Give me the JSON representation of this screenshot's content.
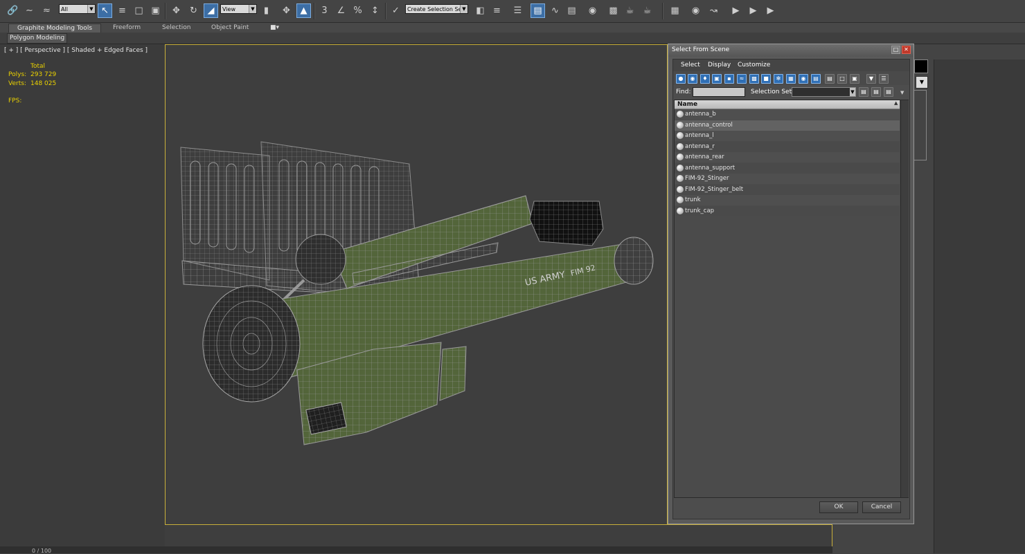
{
  "toolbar": {
    "filter_combo": "All",
    "refcoord_combo": "View",
    "selection_set_combo": "Create Selection Se",
    "snap_label": "3",
    "angle_snap_label": "%"
  },
  "ribbon": {
    "tabs": [
      "Graphite Modeling Tools",
      "Freeform",
      "Selection",
      "Object Paint"
    ],
    "panel": "Polygon Modeling"
  },
  "viewport": {
    "label": "[ + ] [ Perspective ] [ Shaded + Edged Faces ]",
    "stats": {
      "total_label": "Total",
      "polys_label": "Polys:",
      "polys_value": "293 729",
      "verts_label": "Verts:",
      "verts_value": "148 025",
      "fps_label": "FPS:"
    },
    "decal_text_1": "US ARMY",
    "decal_text_2": "FIM 92"
  },
  "timeline": {
    "frame": "0 / 100"
  },
  "dialog": {
    "title": "Select From Scene",
    "menu": [
      "Select",
      "Display",
      "Customize"
    ],
    "find_label": "Find:",
    "find_value": "",
    "selection_set_label": "Selection Set:",
    "column_header": "Name",
    "objects": [
      "antenna_b",
      "antenna_control",
      "antenna_l",
      "antenna_r",
      "antenna_rear",
      "antenna_support",
      "FIM-92_Stinger",
      "FIM-92_Stinger_belt",
      "trunk",
      "trunk_cap"
    ],
    "highlighted_object": "antenna_control",
    "ok_label": "OK",
    "cancel_label": "Cancel"
  },
  "colors": {
    "ui_background": "#444444",
    "viewport_border": "#c9b03a",
    "stats_text": "#ebd200",
    "mesh_wire": "#9a9a9a",
    "mesh_fill": "#53653a",
    "selected_button": "#3c6ea5"
  }
}
